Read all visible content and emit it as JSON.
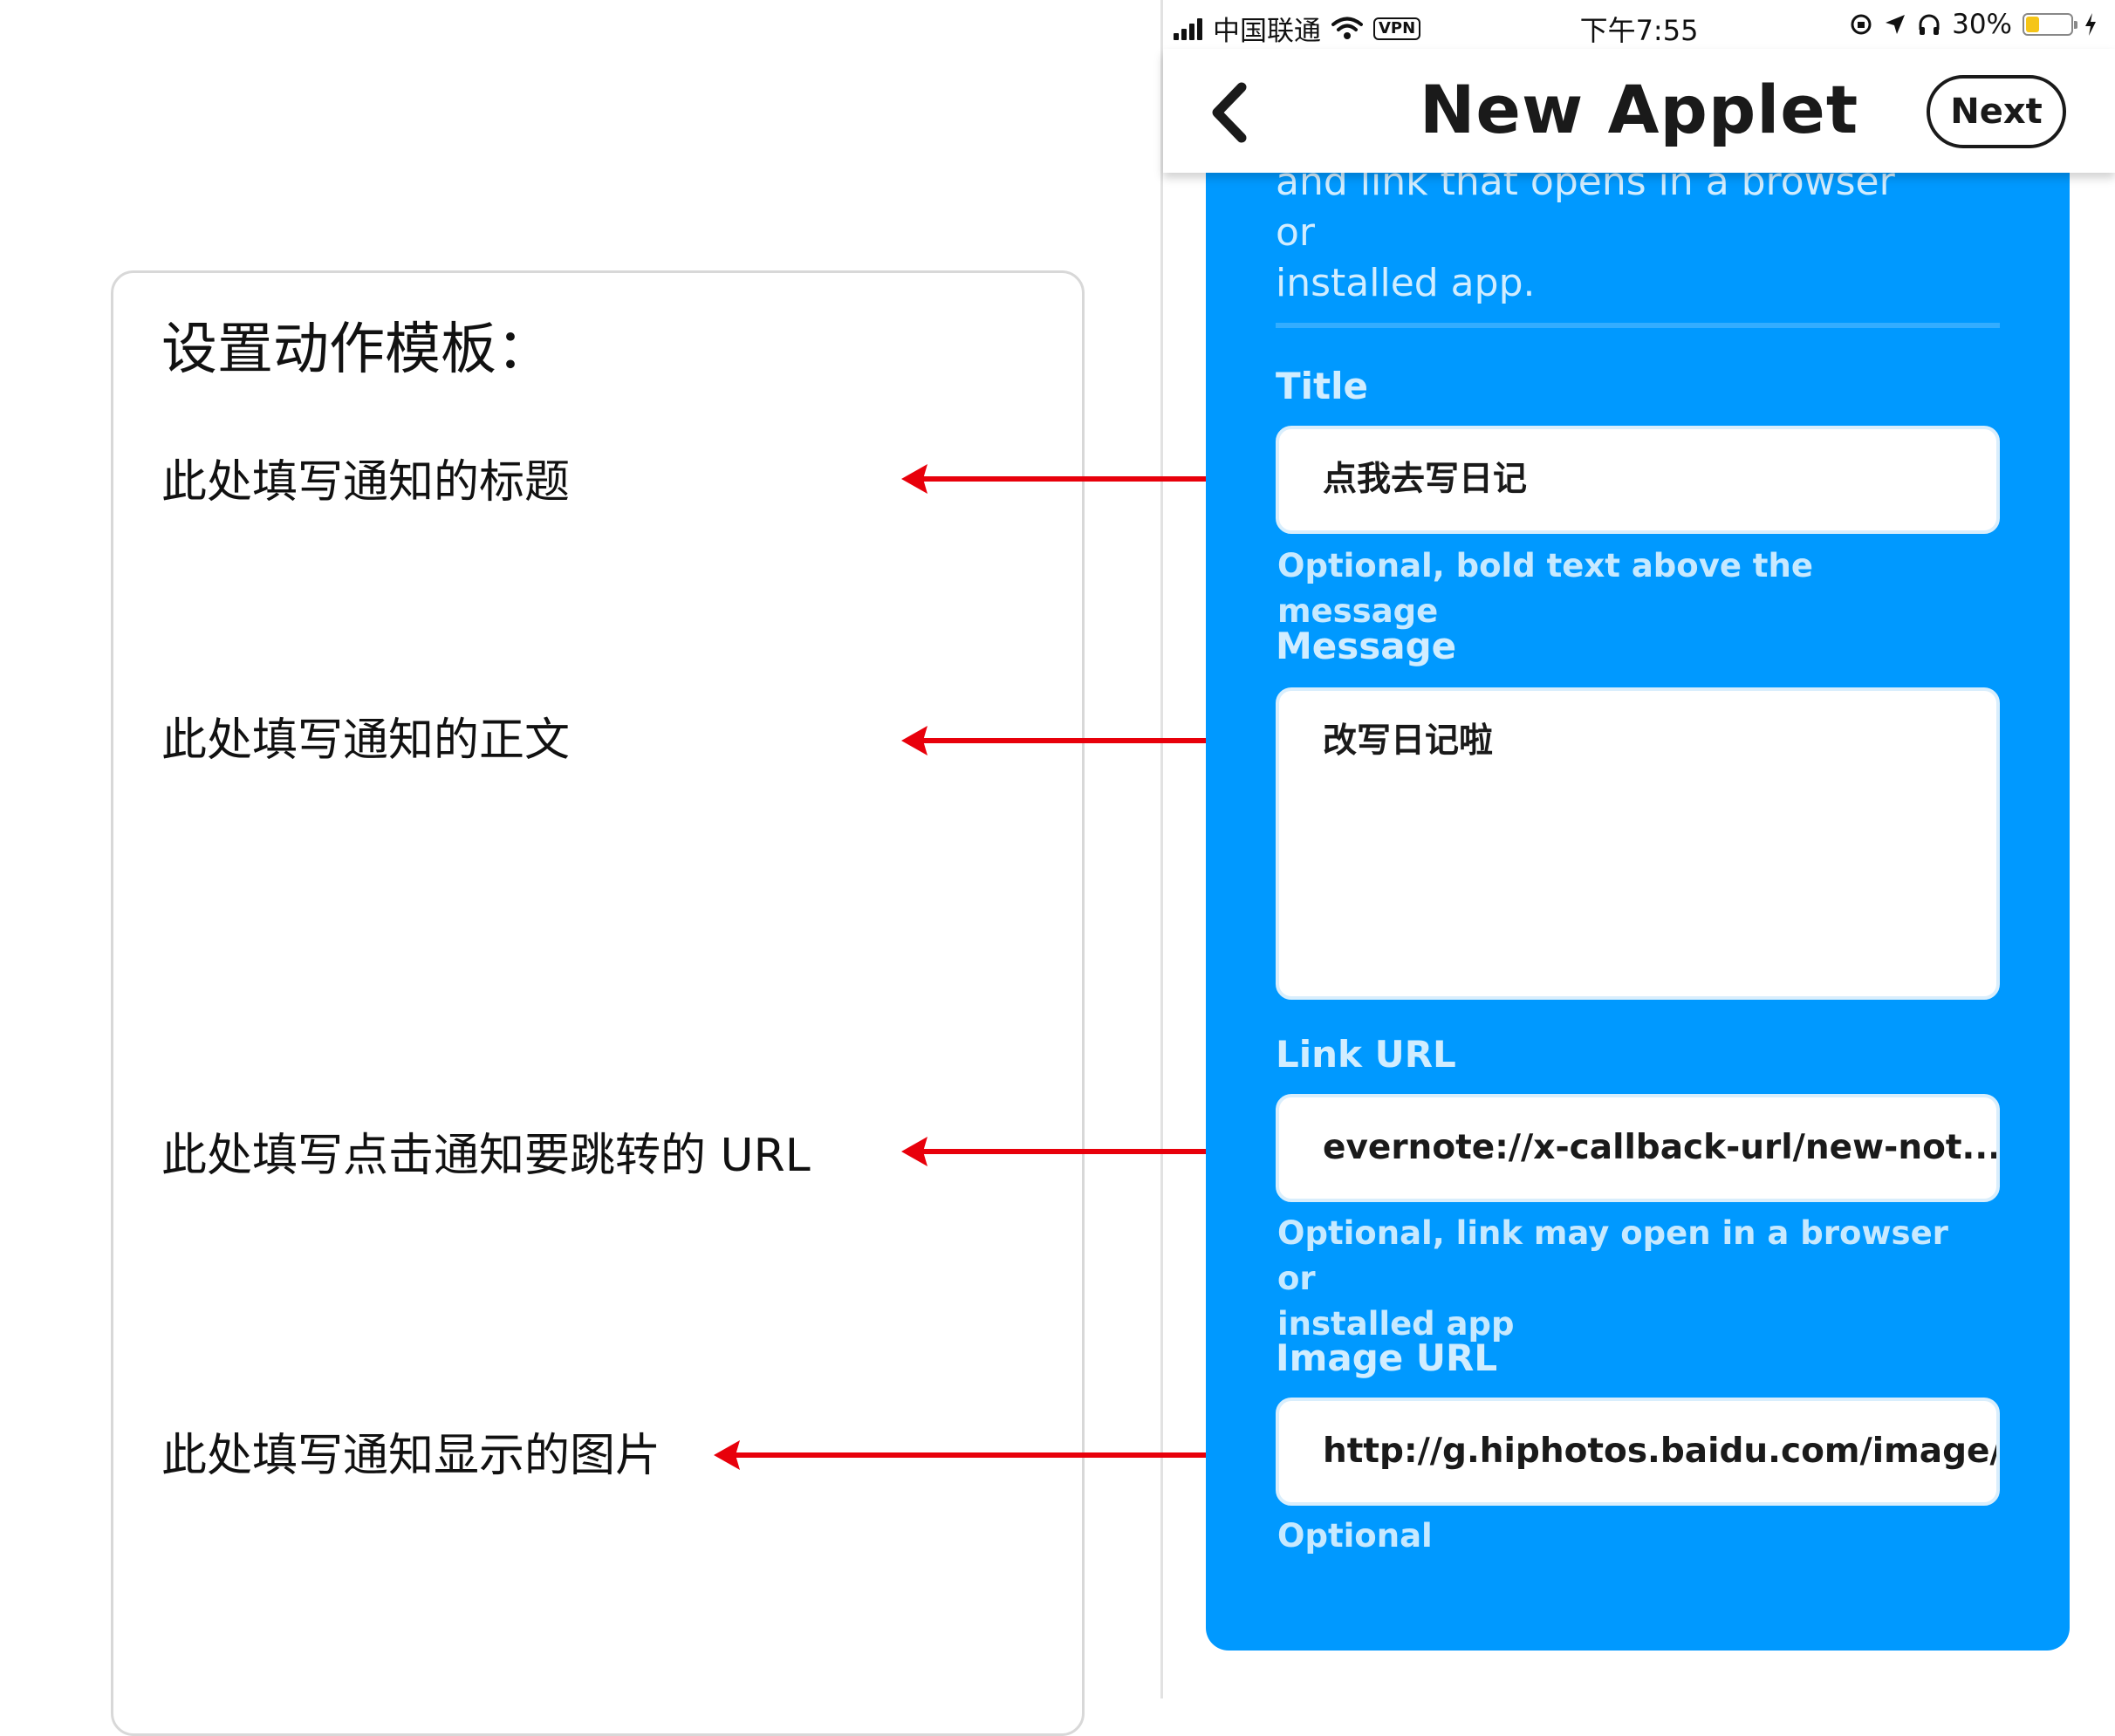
{
  "annotation_panel": {
    "title": "设置动作模板：",
    "notes": [
      "此处填写通知的标题",
      "此处填写通知的正文",
      "此处填写点击通知要跳转的 URL",
      "此处填写通知显示的图片"
    ],
    "arrow_color": "#e8000b"
  },
  "status_bar": {
    "carrier": "中国联通",
    "vpn": "VPN",
    "time": "下午7:55",
    "battery": "30%",
    "battery_level": 0.3,
    "icons": [
      "signal-icon",
      "wifi-icon",
      "rotation-lock-icon",
      "location-icon",
      "headphones-icon",
      "battery-icon",
      "charging-bolt-icon"
    ]
  },
  "nav": {
    "title": "New Applet",
    "next_label": "Next",
    "back_icon": "chevron-left-icon"
  },
  "form": {
    "accent_color": "#0099ff",
    "description_line1": "and link that opens in a browser or",
    "description_line2": "installed app.",
    "fields": {
      "title": {
        "label": "Title",
        "value": "点我去写日记",
        "hint": "Optional, bold text above the message"
      },
      "message": {
        "label": "Message",
        "value": "改写日记啦"
      },
      "link_url": {
        "label": "Link URL",
        "value": "evernote://x-callback-url/new-not...",
        "hint_line1": "Optional, link may open in a browser or",
        "hint_line2": "installed app"
      },
      "image_url": {
        "label": "Image URL",
        "value": "http://g.hiphotos.baidu.com/image/pic/item",
        "hint": "Optional"
      }
    }
  }
}
